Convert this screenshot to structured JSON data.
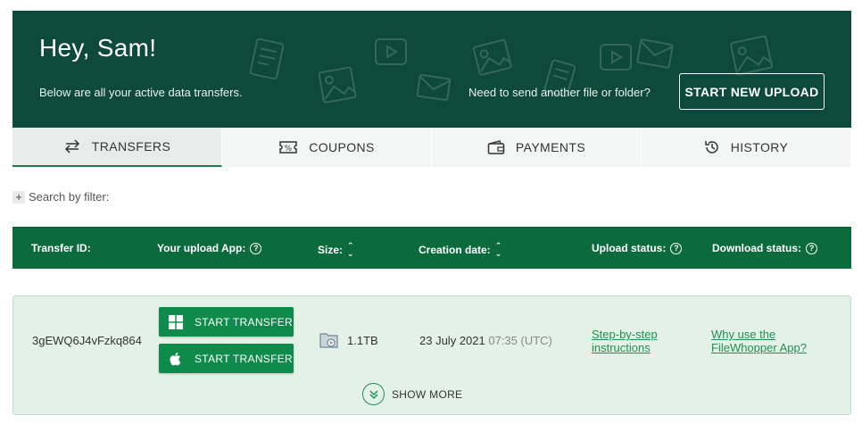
{
  "hero": {
    "greeting": "Hey, Sam!",
    "subtitle": "Below are all your active data transfers.",
    "prompt": "Need to send another file or folder?",
    "upload_button": "START NEW UPLOAD",
    "background_color": "#0e4a3c"
  },
  "tabs": [
    {
      "label": "TRANSFERS",
      "icon": "transfer-arrows-icon",
      "active": true
    },
    {
      "label": "COUPONS",
      "icon": "coupon-icon",
      "active": false
    },
    {
      "label": "PAYMENTS",
      "icon": "wallet-icon",
      "active": false
    },
    {
      "label": "HISTORY",
      "icon": "history-icon",
      "active": false
    }
  ],
  "filter": {
    "label": "Search by filter:"
  },
  "table": {
    "header_color": "#0b6b3c",
    "columns": {
      "transfer_id": "Transfer ID:",
      "upload_app": "Your upload App:",
      "size": "Size:",
      "creation_date": "Creation date:",
      "upload_status": "Upload status:",
      "download_status": "Download status:"
    },
    "row": {
      "transfer_id": "3gEWQ6J4vFzkq864",
      "windows_button": "START TRANSFER",
      "mac_button": "START TRANSFER",
      "size": "1.1TB",
      "date": "23 July 2021",
      "time": "07:35 (UTC)",
      "upload_link_line1": "Step-by-step",
      "upload_link_line2": "instructions",
      "download_link_line1": "Why use the",
      "download_link_line2": "FileWhopper App?",
      "show_more": "SHOW MORE"
    }
  }
}
